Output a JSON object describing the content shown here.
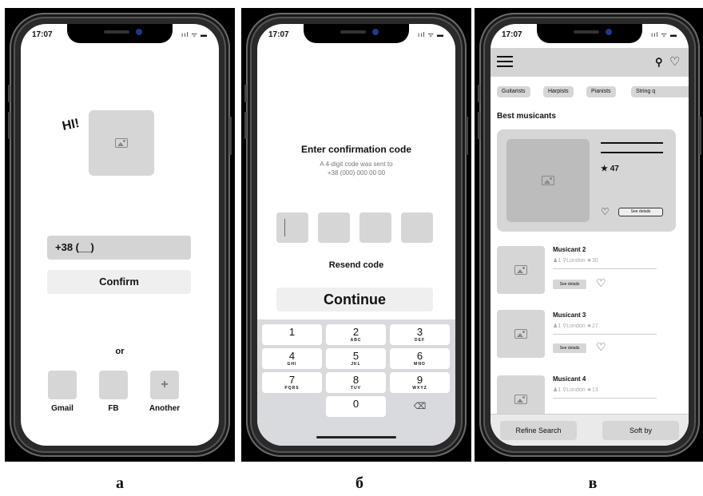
{
  "screens": {
    "a": {
      "time": "17:07",
      "status_icons": "ııl ᯤ ▬",
      "greeting": "HI!",
      "phone_prefix": "+38 (__)",
      "confirm_label": "Confirm",
      "or_label": "or",
      "social": [
        {
          "label": "Gmail",
          "icon": ""
        },
        {
          "label": "FB",
          "icon": ""
        },
        {
          "label": "Another",
          "icon": "+"
        }
      ],
      "caption": "а"
    },
    "b": {
      "time": "17:07",
      "status_icons": "ııl ᯤ ▬",
      "title": "Enter confirmation code",
      "subtitle_line1": "A 4-digit code was sent to",
      "subtitle_line2": "+38 (000) 000 00 00",
      "resend_label": "Resend code",
      "continue_label": "Continue",
      "keys": [
        {
          "n": "1",
          "l": ""
        },
        {
          "n": "2",
          "l": "ABC"
        },
        {
          "n": "3",
          "l": "DEF"
        },
        {
          "n": "4",
          "l": "GHI"
        },
        {
          "n": "5",
          "l": "JKL"
        },
        {
          "n": "6",
          "l": "MNO"
        },
        {
          "n": "7",
          "l": "PQRS"
        },
        {
          "n": "8",
          "l": "TUV"
        },
        {
          "n": "9",
          "l": "WXYZ"
        },
        {
          "n": "0",
          "l": ""
        }
      ],
      "backspace_icon": "⌫",
      "caption": "б"
    },
    "c": {
      "time": "17:07",
      "status_icons": "ııl ᯤ ▬",
      "search_icon": "⚲",
      "heart_icon": "♡",
      "chips": [
        "Guitarists",
        "Harpists",
        "Pianists",
        "String q"
      ],
      "section_title": "Best musicants",
      "featured": {
        "rating": "★ 47",
        "heart": "♡",
        "see_details": "See details"
      },
      "items": [
        {
          "name": "Musicant 2",
          "meta": "♟1  ⚲London  ★30",
          "see_details": "See details",
          "heart": "♡"
        },
        {
          "name": "Musicant 3",
          "meta": "♟1  ⚲London  ★27",
          "see_details": "See details",
          "heart": "♡"
        },
        {
          "name": "Musicant 4",
          "meta": "♟1  ⚲London  ★13",
          "see_details": "",
          "heart": ""
        }
      ],
      "refine_label": "Refine Search",
      "sort_label": "Soft by",
      "caption": "в"
    }
  }
}
